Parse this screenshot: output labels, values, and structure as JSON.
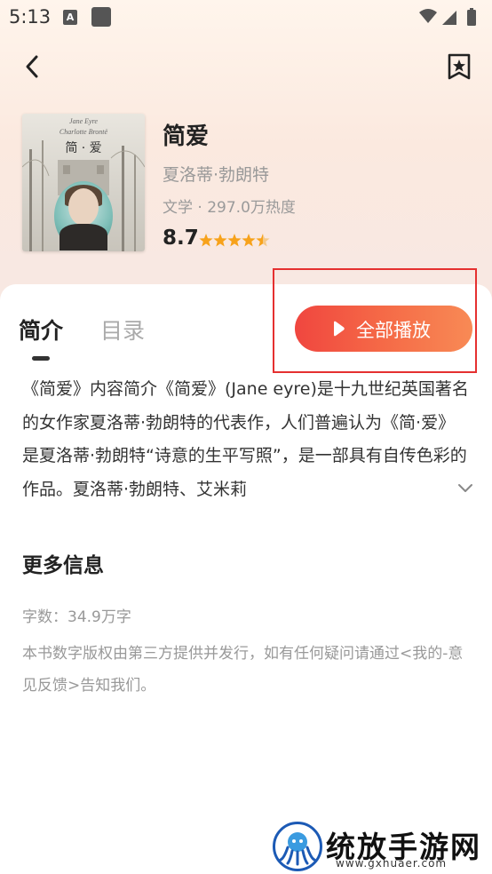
{
  "status_bar": {
    "time": "5:13",
    "a_icon": "A"
  },
  "nav": {
    "back_icon": "chevron-left-icon",
    "bookmark_icon": "bookmark-star-icon"
  },
  "book": {
    "cover_line1": "Jane Eyre",
    "cover_line2": "Charlotte Brontë",
    "cover_title": "简 · 爱",
    "title": "简爱",
    "author": "夏洛蒂·勃朗特",
    "meta": "文学 · 297.0万热度",
    "score": "8.7",
    "rating_stars": 4.5
  },
  "tabs": {
    "intro": "简介",
    "toc": "目录"
  },
  "play": {
    "label": "全部播放",
    "accent_start": "#f0463f",
    "accent_end": "#f88a55",
    "highlight_color": "#e53030"
  },
  "intro": {
    "text": "《简爱》内容简介《简爱》(Jane eyre)是十九世纪英国著名的女作家夏洛蒂·勃朗特的代表作，人们普遍认为《简·爱》是夏洛蒂·勃朗特“诗意的生平写照”，是一部具有自传色彩的作品。夏洛蒂·勃朗特、艾米莉"
  },
  "more_info": {
    "title": "更多信息",
    "word_count": "字数：34.9万字",
    "copyright": "本书数字版权由第三方提供并发行，如有任何疑问请通过<我的-意见反馈>告知我们。"
  },
  "watermark": {
    "text": "统放手游网",
    "url": "www.gxhuaer.com"
  }
}
